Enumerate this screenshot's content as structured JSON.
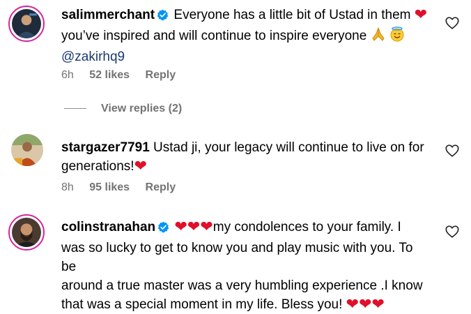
{
  "comments": [
    {
      "username": "salimmerchant",
      "verified": true,
      "text_1": "Everyone has a little bit of Ustad in them",
      "text_2": "you’ve inspired and will continue to inspire everyone",
      "mention": "@zakirhq9",
      "time": "6h",
      "likes": "52 likes",
      "reply": "Reply",
      "view_replies": "View replies (2)"
    },
    {
      "username": "stargazer7791",
      "verified": false,
      "text_1": "Ustad ji, your legacy will continue to live on for",
      "text_2": "generations!",
      "time": "8h",
      "likes": "95 likes",
      "reply": "Reply"
    },
    {
      "username": "colinstranahan",
      "verified": true,
      "text_1": "my condolences to your family. I",
      "text_2": "was so lucky to get to know you and play music with you. To be",
      "text_3": "around a true master was a very humbling experience .I know",
      "text_4": "that was a special moment in my life. Bless you!"
    }
  ],
  "icons": {
    "verified": "verified-badge-icon",
    "heart": "heart-icon",
    "like": "like-heart-outline-icon",
    "pray": "folded-hands-emoji",
    "smile": "smiling-halo-emoji"
  },
  "colors": {
    "verified": "#0095f6",
    "heart": "#e0102a",
    "mention": "#1a3a70",
    "meta": "#737373",
    "story_ring": "#d6249f"
  }
}
